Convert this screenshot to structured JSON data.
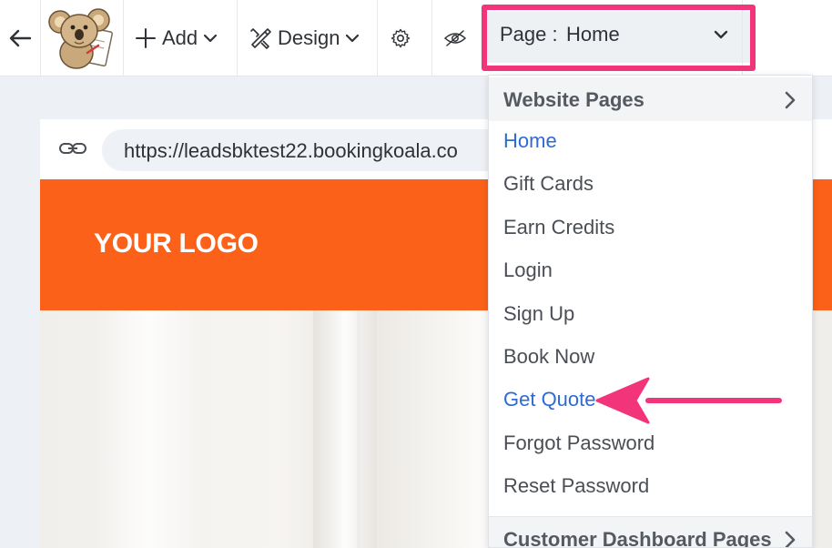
{
  "toolbar": {
    "add_label": "Add",
    "design_label": "Design",
    "page_select": {
      "label": "Page :",
      "value": "Home"
    }
  },
  "preview": {
    "url": "https://leadsbktest22.bookingkoala.co",
    "site_logo_text": "YOUR LOGO"
  },
  "dropdown": {
    "section_website": "Website Pages",
    "items": [
      {
        "label": "Home",
        "style": "link"
      },
      {
        "label": "Gift Cards",
        "style": "normal"
      },
      {
        "label": "Earn Credits",
        "style": "normal"
      },
      {
        "label": "Login",
        "style": "normal"
      },
      {
        "label": "Sign Up",
        "style": "normal"
      },
      {
        "label": "Book Now",
        "style": "normal"
      },
      {
        "label": "Get Quote",
        "style": "link"
      },
      {
        "label": "Forgot Password",
        "style": "normal"
      },
      {
        "label": "Reset Password",
        "style": "normal"
      }
    ],
    "section_customer": "Customer Dashboard Pages"
  },
  "colors": {
    "accent_orange": "#fb6118",
    "highlight_pink": "#f2357a",
    "link_blue": "#2e6ad6"
  },
  "icons": [
    "back-arrow-icon",
    "koala-logo",
    "plus-icon",
    "chevron-down-icon",
    "design-tools-icon",
    "gear-icon",
    "eye-off-icon",
    "link-icon",
    "chevron-right-icon",
    "annotation-arrow"
  ]
}
